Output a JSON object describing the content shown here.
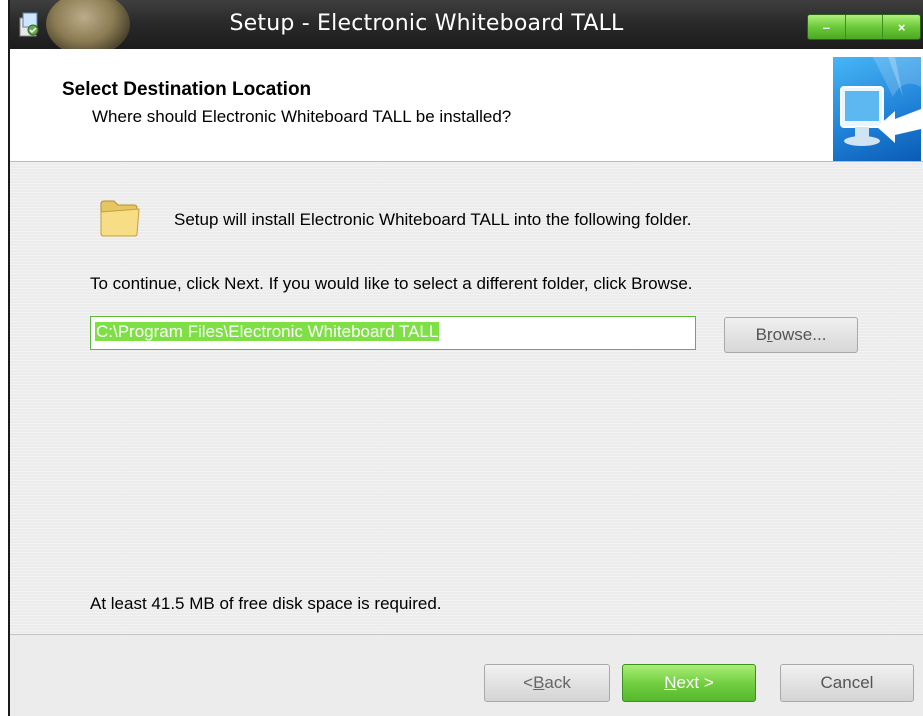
{
  "window": {
    "title": "Setup - Electronic Whiteboard TALL",
    "controls": {
      "minimize": "–",
      "maximize": "",
      "close": "×"
    }
  },
  "header": {
    "title": "Select Destination Location",
    "subtitle": "Where should Electronic Whiteboard TALL be installed?"
  },
  "body": {
    "intro": "Setup will install Electronic Whiteboard TALL into the following folder.",
    "continue": "To continue, click Next. If you would like to select a different folder, click Browse.",
    "destination": "C:\\Program Files\\Electronic Whiteboard TALL",
    "browse_pre": "B",
    "browse_key": "r",
    "browse_post": "owse...",
    "disk_space": "At least 41.5 MB of free disk space is required."
  },
  "footer": {
    "back_pre": "< ",
    "back_key": "B",
    "back_post": "ack",
    "next_key": "N",
    "next_post": "ext >",
    "cancel": "Cancel"
  },
  "icons": {
    "app": "setup-app-icon",
    "header_image": "computer-monitor-arrow-icon",
    "folder": "folder-icon"
  },
  "colors": {
    "accent_green": "#73cf42",
    "titlebar": "#2a2a2a",
    "selection": "#7ee044"
  }
}
